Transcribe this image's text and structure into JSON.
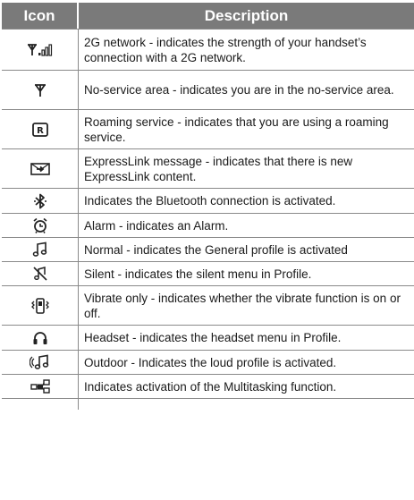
{
  "header": {
    "icon_col": "Icon",
    "desc_col": "Description"
  },
  "rows": [
    {
      "icon": "signal-strength-icon",
      "text": "2G network - indicates the strength of your handset’s connection with a 2G network."
    },
    {
      "icon": "antenna-icon",
      "text": "No-service area - indicates you are in the no-service area."
    },
    {
      "icon": "roaming-icon",
      "text": "Roaming service - indicates that you are using a roaming service."
    },
    {
      "icon": "expresslink-icon",
      "text": "ExpressLink message - indicates that there is new ExpressLink content."
    },
    {
      "icon": "bluetooth-icon",
      "text": "Indicates the Bluetooth connection is activated."
    },
    {
      "icon": "alarm-clock-icon",
      "text": "Alarm - indicates an Alarm."
    },
    {
      "icon": "music-note-icon",
      "text": "Normal - indicates the General profile is activated"
    },
    {
      "icon": "silent-icon",
      "text": "Silent - indicates the silent menu in Profile."
    },
    {
      "icon": "vibrate-icon",
      "text": "Vibrate only - indicates whether the vibrate function is on or off."
    },
    {
      "icon": "headset-icon",
      "text": "Headset - indicates the headset menu in Profile."
    },
    {
      "icon": "outdoor-icon",
      "text": "Outdoor - Indicates the loud profile is activated."
    },
    {
      "icon": "multitasking-icon",
      "text": "Indicates activation of the Multitasking function."
    }
  ]
}
